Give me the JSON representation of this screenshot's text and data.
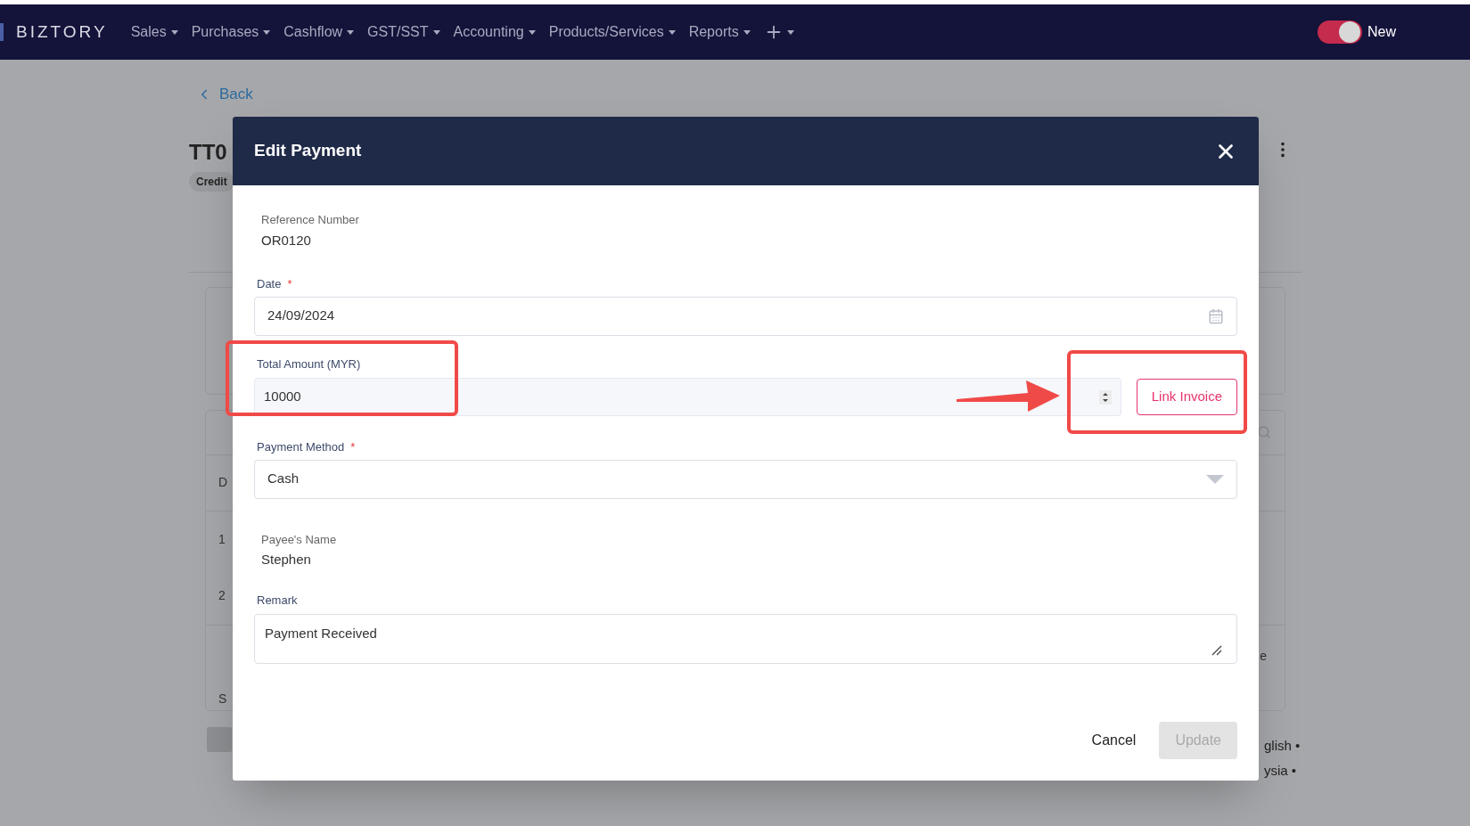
{
  "nav": {
    "logo": "BIZTORY",
    "menus": [
      {
        "label": "Sales"
      },
      {
        "label": "Purchases"
      },
      {
        "label": "Cashflow"
      },
      {
        "label": "GST/SST"
      },
      {
        "label": "Accounting"
      },
      {
        "label": "Products/Services"
      },
      {
        "label": "Reports"
      }
    ],
    "toggle": {
      "label": "New",
      "on": true
    }
  },
  "page_behind": {
    "back_link": "Back",
    "title": "TT0",
    "tag": "Credit",
    "table_cells": [
      "D",
      "1",
      "2"
    ],
    "summary_cell": "S",
    "right_cell": "e",
    "footer_lines": [
      "glish •",
      "ysia •"
    ]
  },
  "dialog": {
    "title": "Edit Payment",
    "fields": [
      {
        "kind": "readonly",
        "label": "Reference Number",
        "value": "OR0120"
      },
      {
        "kind": "date",
        "label": "Date",
        "required_mark": "*",
        "value": "24/09/2024"
      },
      {
        "kind": "number",
        "label": "Total Amount (MYR)",
        "value": "10000",
        "action": "Link Invoice"
      },
      {
        "kind": "select",
        "label": "Payment Method",
        "required_mark": "*",
        "value": "Cash"
      },
      {
        "kind": "readonly",
        "label": "Payee's Name",
        "value": "Stephen"
      },
      {
        "kind": "textarea",
        "label": "Remark",
        "value": "Payment Received"
      }
    ],
    "cancel": "Cancel",
    "submit": {
      "label": "Update",
      "disabled": true
    }
  }
}
